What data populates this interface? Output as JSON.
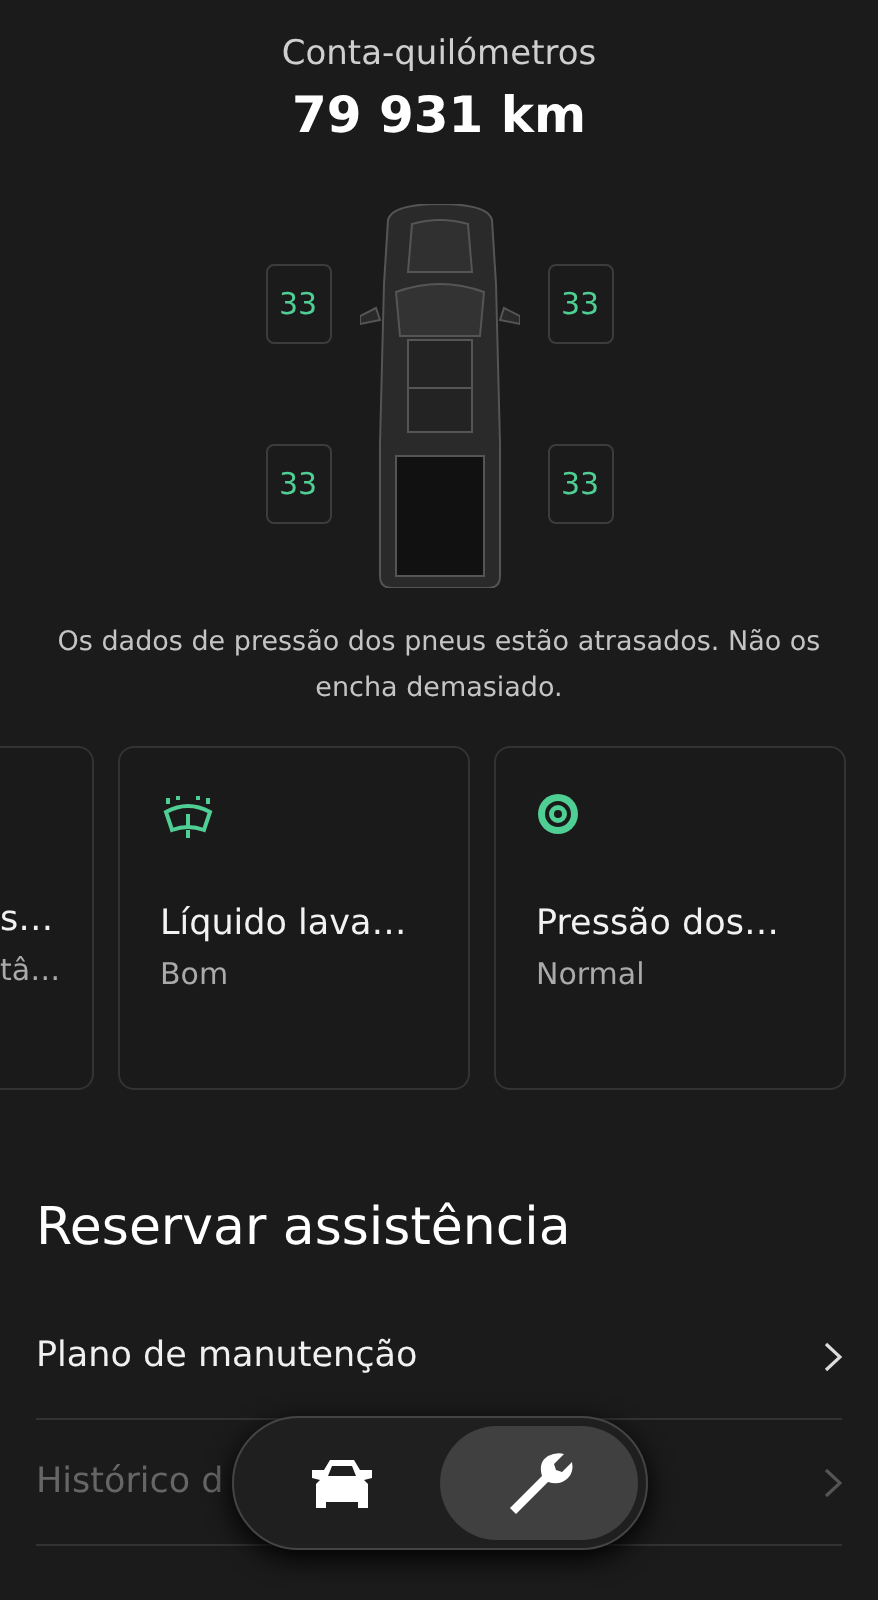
{
  "header": {
    "title": "Conta-quilómetros",
    "odometer": "79 931 km"
  },
  "tires": [
    {
      "value": "33"
    },
    {
      "value": "33"
    },
    {
      "value": "33"
    },
    {
      "value": "33"
    }
  ],
  "tire_note": "Os dados de pressão dos pneus estão atrasados. Não os encha demasiado.",
  "status_cards": [
    {
      "kind": "clipped",
      "title": "s…",
      "status": "tâ…"
    },
    {
      "kind": "washer",
      "title": "Líquido lava…",
      "status": "Bom"
    },
    {
      "kind": "tire",
      "title": "Pressão dos…",
      "status": "Normal"
    }
  ],
  "service": {
    "title": "Reservar assistência",
    "items": [
      {
        "label": "Plano de manutenção",
        "disabled": false
      },
      {
        "label": "Histórico d",
        "disabled": true
      }
    ]
  },
  "nav": [
    {
      "kind": "car",
      "selected": false
    },
    {
      "kind": "wrench",
      "selected": true
    }
  ]
}
